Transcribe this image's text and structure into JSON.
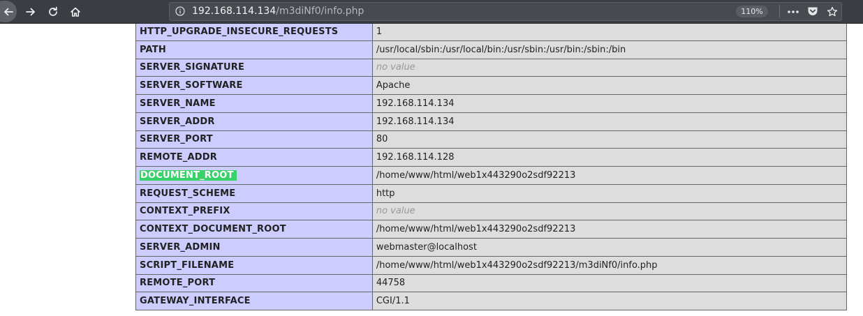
{
  "browser": {
    "url_host": "192.168.114.134",
    "url_path": "/m3diNf0/info.php",
    "zoom": "110%",
    "icons": [
      "back-icon",
      "forward-icon",
      "reload-icon",
      "home-icon",
      "info-icon",
      "more-icon",
      "pocket-icon",
      "bookmark-star-icon"
    ]
  },
  "rows": [
    {
      "key": "HTTP_UPGRADE_INSECURE_REQUESTS",
      "value": "1"
    },
    {
      "key": "PATH",
      "value": "/usr/local/sbin:/usr/local/bin:/usr/sbin:/usr/bin:/sbin:/bin"
    },
    {
      "key": "SERVER_SIGNATURE",
      "value": "no value"
    },
    {
      "key": "SERVER_SOFTWARE",
      "value": "Apache"
    },
    {
      "key": "SERVER_NAME",
      "value": "192.168.114.134"
    },
    {
      "key": "SERVER_ADDR",
      "value": "192.168.114.134"
    },
    {
      "key": "SERVER_PORT",
      "value": "80"
    },
    {
      "key": "REMOTE_ADDR",
      "value": "192.168.114.128"
    },
    {
      "key": "DOCUMENT_ROOT",
      "value": "/home/www/html/web1x443290o2sdf92213"
    },
    {
      "key": "REQUEST_SCHEME",
      "value": "http"
    },
    {
      "key": "CONTEXT_PREFIX",
      "value": "no value"
    },
    {
      "key": "CONTEXT_DOCUMENT_ROOT",
      "value": "/home/www/html/web1x443290o2sdf92213"
    },
    {
      "key": "SERVER_ADMIN",
      "value": "webmaster@localhost"
    },
    {
      "key": "SCRIPT_FILENAME",
      "value": "/home/www/html/web1x443290o2sdf92213/m3diNf0/info.php"
    },
    {
      "key": "REMOTE_PORT",
      "value": "44758"
    },
    {
      "key": "GATEWAY_INTERFACE",
      "value": "CGI/1.1"
    }
  ],
  "colors": {
    "key_cell": "#ccccff",
    "value_cell": "#dddddd",
    "highlight": "#39d16a",
    "no_value_text": "#999999"
  }
}
